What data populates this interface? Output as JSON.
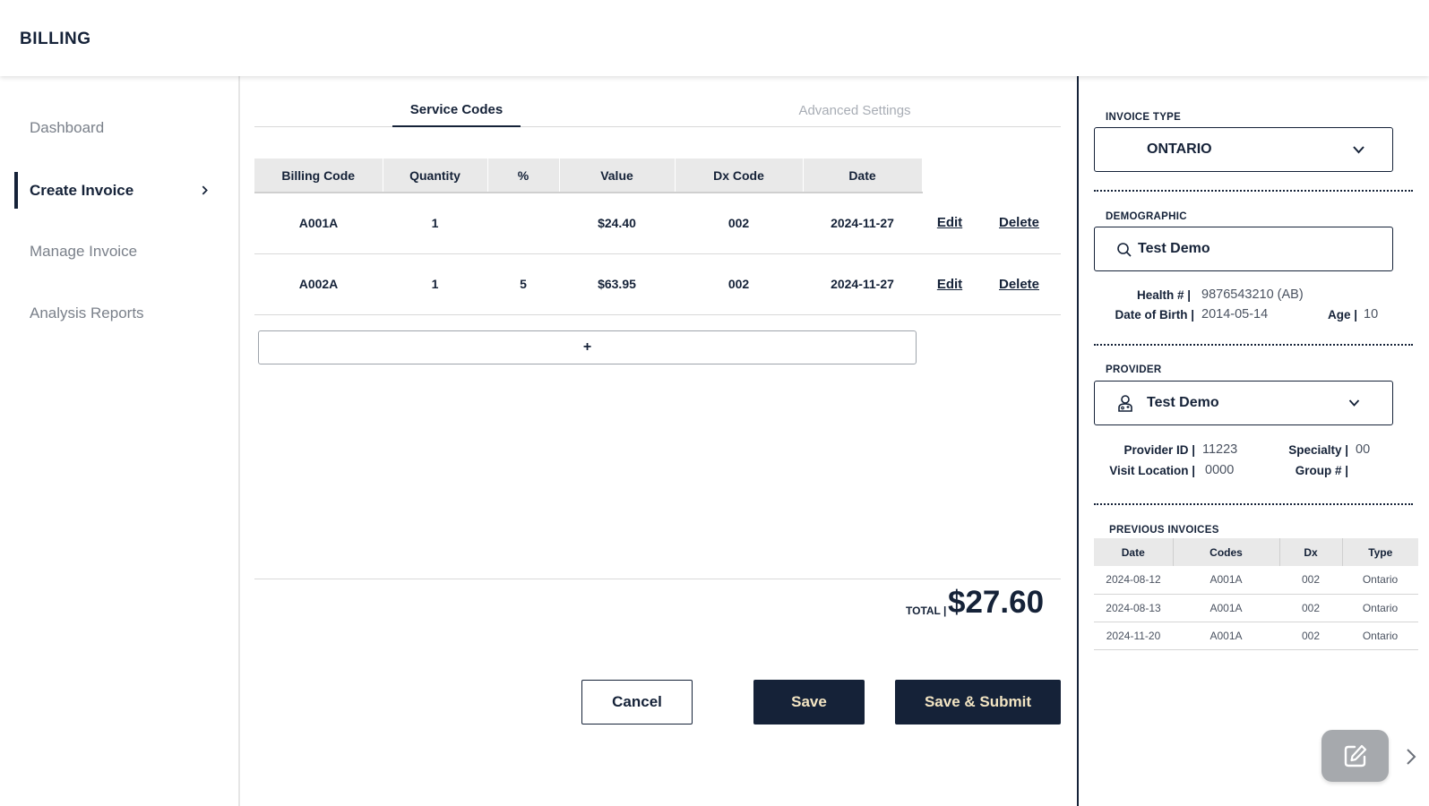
{
  "header": {
    "title": "BILLING"
  },
  "sidebar": {
    "items": [
      {
        "label": "Dashboard"
      },
      {
        "label": "Create Invoice"
      },
      {
        "label": "Manage Invoice"
      },
      {
        "label": "Analysis Reports"
      }
    ]
  },
  "tabs": [
    {
      "label": "Service Codes"
    },
    {
      "label": "Advanced Settings"
    }
  ],
  "service_table": {
    "headers": [
      "Billing Code",
      "Quantity",
      "%",
      "Value",
      "Dx Code",
      "Date"
    ],
    "rows": [
      {
        "billing_code": "A001A",
        "quantity": "1",
        "percent": "",
        "value": "$24.40",
        "dx_code": "002",
        "date": "2024-11-27",
        "edit": "Edit",
        "delete": "Delete"
      },
      {
        "billing_code": "A002A",
        "quantity": "1",
        "percent": "5",
        "value": "$63.95",
        "dx_code": "002",
        "date": "2024-11-27",
        "edit": "Edit",
        "delete": "Delete"
      }
    ],
    "add_label": "+"
  },
  "total": {
    "label": "TOTAL |",
    "value": "$27.60"
  },
  "actions": {
    "cancel": "Cancel",
    "save": "Save",
    "submit": "Save & Submit"
  },
  "invoice_type": {
    "label": "INVOICE TYPE",
    "value": "ONTARIO"
  },
  "demographic": {
    "label": "DEMOGRAPHIC",
    "search_value": "Test Demo",
    "health_label": "Health # |",
    "health_value": "9876543210 (AB)",
    "dob_label": "Date of Birth |",
    "dob_value": "2014-05-14",
    "age_label": "Age |",
    "age_value": "10"
  },
  "provider": {
    "label": "PROVIDER",
    "value": "Test Demo",
    "id_label": "Provider ID |",
    "id_value": "11223",
    "specialty_label": "Specialty |",
    "specialty_value": "00",
    "location_label": "Visit Location |",
    "location_value": "0000",
    "group_label": "Group # |",
    "group_value": ""
  },
  "previous_invoices": {
    "label": "PREVIOUS INVOICES",
    "headers": [
      "Date",
      "Codes",
      "Dx",
      "Type"
    ],
    "rows": [
      {
        "date": "2024-08-12",
        "codes": "A001A",
        "dx": "002",
        "type": "Ontario"
      },
      {
        "date": "2024-08-13",
        "codes": "A001A",
        "dx": "002",
        "type": "Ontario"
      },
      {
        "date": "2024-11-20",
        "codes": "A001A",
        "dx": "002",
        "type": "Ontario"
      }
    ]
  },
  "icons": {
    "search": "search-icon",
    "provider": "doctor-icon",
    "dropdown": "chevron-down-icon",
    "edit_fab": "edit-note-icon",
    "expand": "chevron-right-icon"
  },
  "colors": {
    "primary": "#152238",
    "button_text": "#f3e5c3",
    "fab": "#a6a9ad"
  }
}
